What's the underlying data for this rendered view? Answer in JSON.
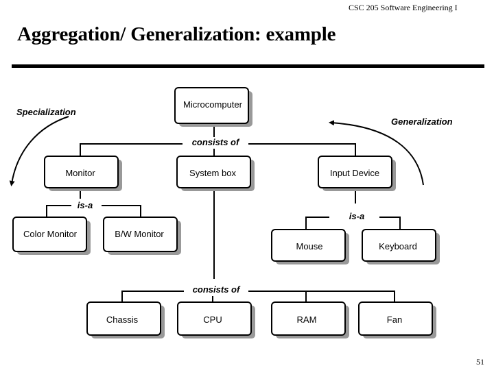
{
  "header": {
    "course": "CSC 205 Software Engineering I"
  },
  "slide": {
    "title": "Aggregation/ Generalization: example",
    "page_number": "51"
  },
  "diagram": {
    "side_labels": {
      "specialization": "Specialization",
      "generalization": "Generalization"
    },
    "relations": {
      "consists_of_top": "consists of",
      "is_a_left": "is-a",
      "is_a_right": "is-a",
      "consists_of_bottom": "consists of"
    },
    "nodes": {
      "microcomputer": "Microcomputer",
      "monitor": "Monitor",
      "system_box": "System box",
      "input_device": "Input Device",
      "color_monitor": "Color Monitor",
      "bw_monitor": "B/W Monitor",
      "mouse": "Mouse",
      "keyboard": "Keyboard",
      "chassis": "Chassis",
      "cpu": "CPU",
      "ram": "RAM",
      "fan": "Fan"
    }
  }
}
